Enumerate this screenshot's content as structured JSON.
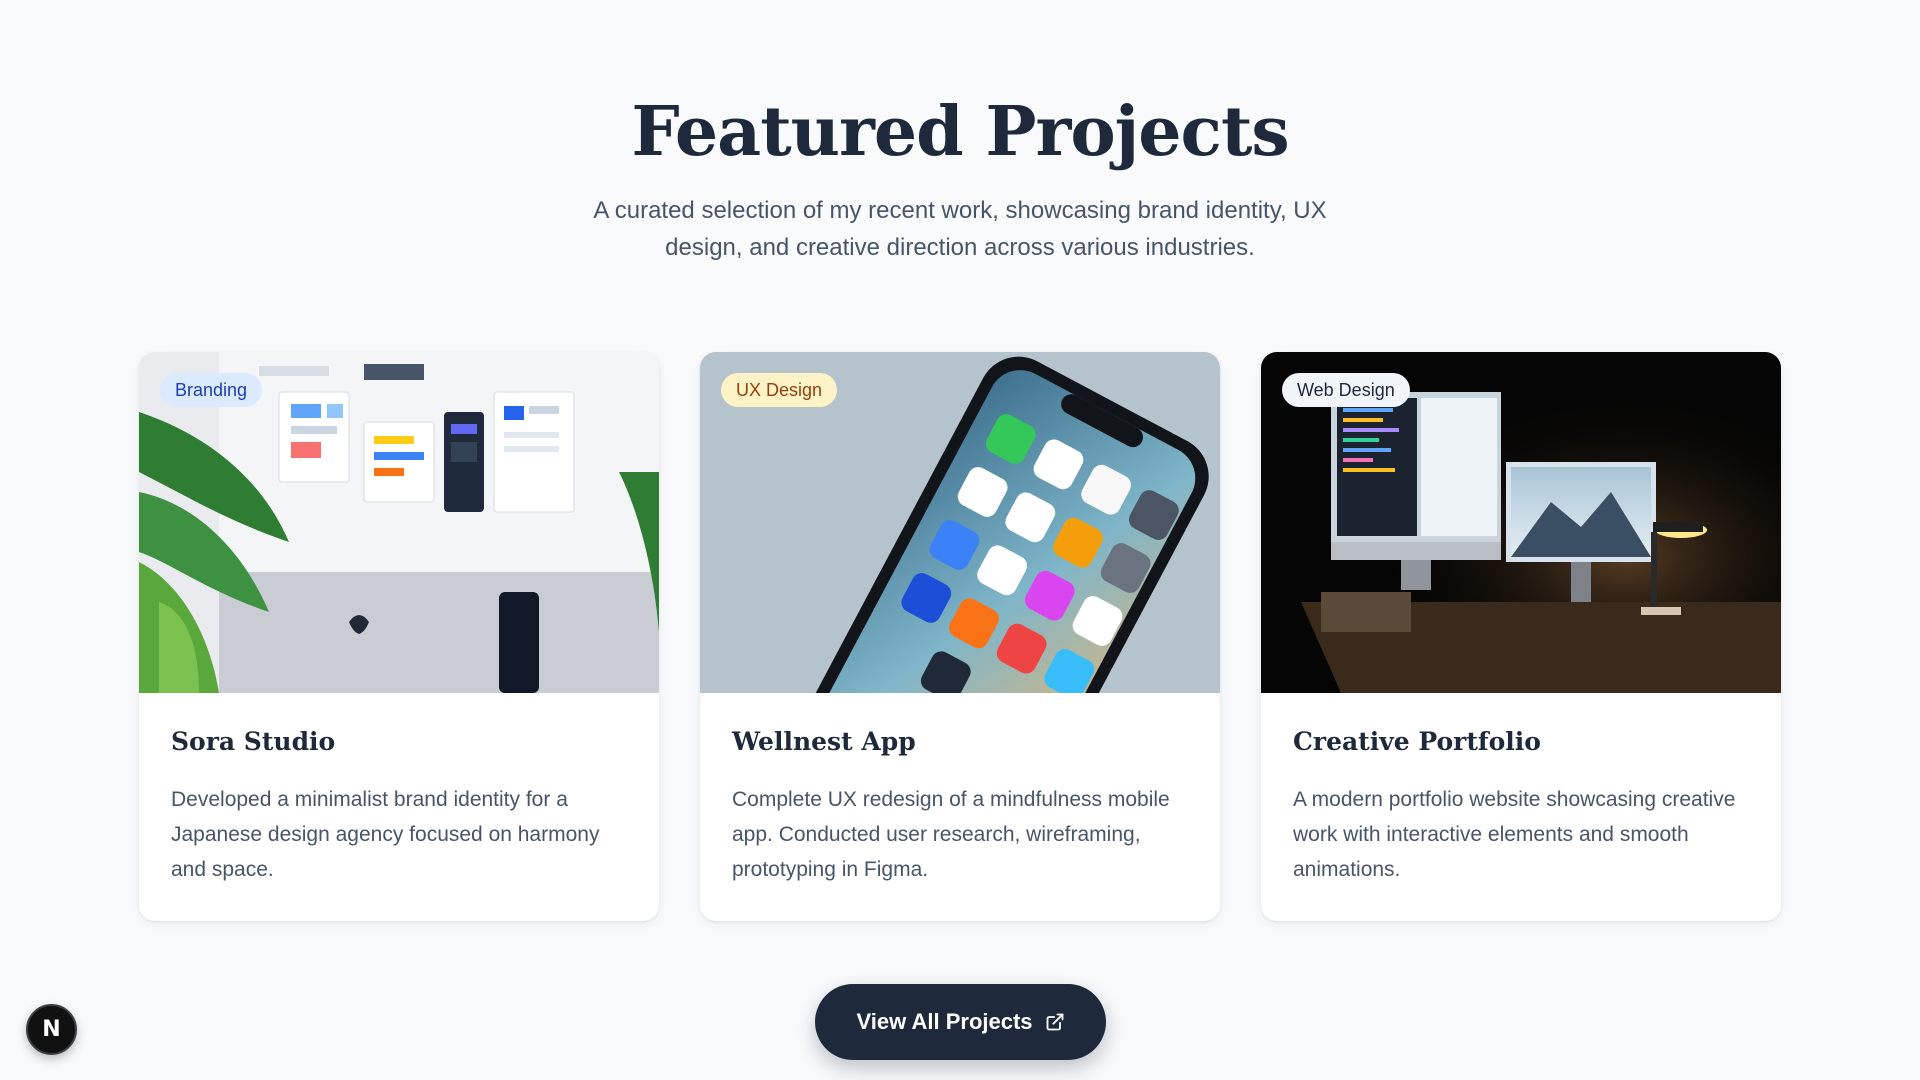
{
  "header": {
    "title": "Featured Projects",
    "subtitle": "A curated selection of my recent work, showcasing brand identity, UX design, and creative direction across various industries."
  },
  "projects": [
    {
      "tag": "Branding",
      "title": "Sora Studio",
      "description": "Developed a minimalist brand identity for a Japanese design agency focused on harmony and space."
    },
    {
      "tag": "UX Design",
      "title": "Wellnest App",
      "description": "Complete UX redesign of a mindfulness mobile app. Conducted user research, wireframing, prototyping in Figma."
    },
    {
      "tag": "Web Design",
      "title": "Creative Portfolio",
      "description": "A modern portfolio website showcasing creative work with interactive elements and smooth animations."
    }
  ],
  "cta": {
    "label": "View All Projects",
    "icon": "external-link-icon"
  },
  "dev_badge": {
    "letter": "N",
    "icon": "nextjs-logo-icon"
  },
  "colors": {
    "background": "#f8fafc",
    "heading": "#1e293b",
    "body_text": "#475569",
    "button_bg": "#1e293b",
    "tag_branding_bg": "#dbeafe",
    "tag_ux_bg": "#fef3c7",
    "tag_web_bg": "#f1f5f9"
  }
}
